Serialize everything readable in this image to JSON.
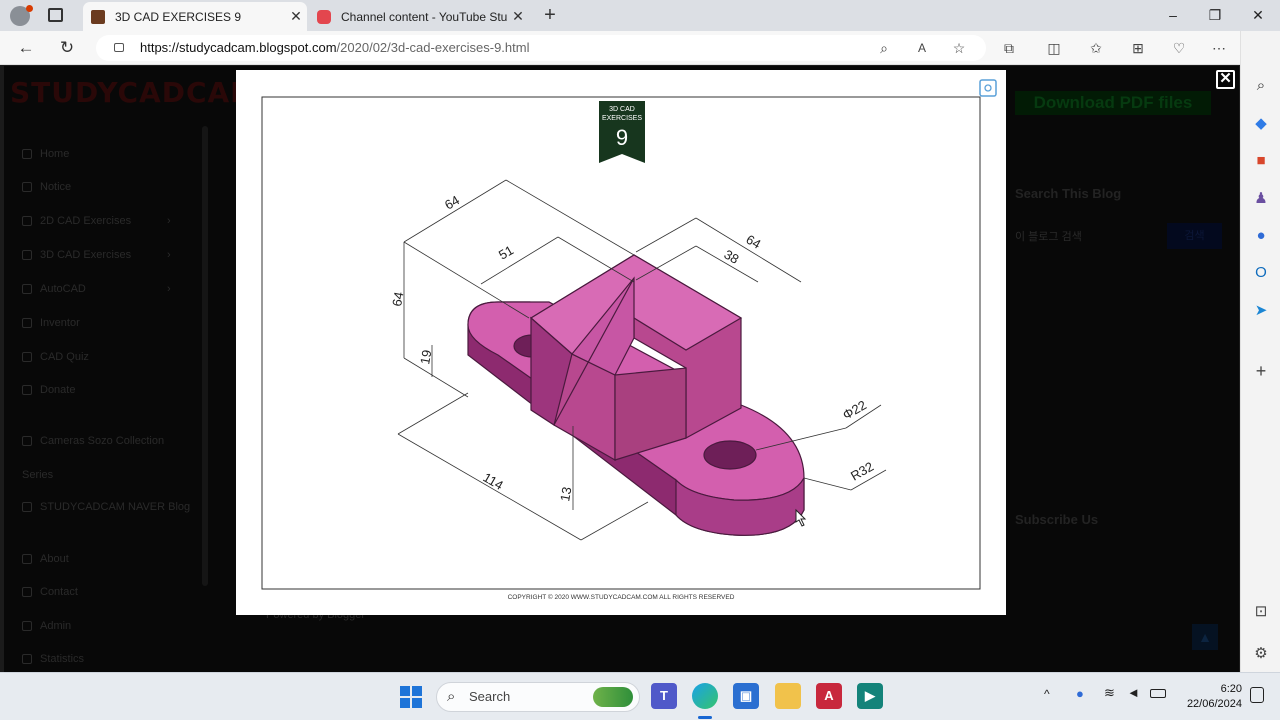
{
  "browser": {
    "tabs": [
      {
        "title": "3D CAD EXERCISES 9",
        "active": true
      },
      {
        "title": "Channel content - YouTube Studio",
        "active": false
      }
    ],
    "url_host": "https://studycadcam.blogspot.com",
    "url_path": "/2020/02/3d-cad-exercises-9.html"
  },
  "site": {
    "logo": "STUDYCADCAM",
    "nav": [
      "Home",
      "Notice",
      "2D CAD Exercises",
      "3D CAD Exercises",
      "AutoCAD",
      "Inventor",
      "CAD Quiz",
      "Donate",
      "Cameras Sozo Collection",
      "Series",
      "STUDYCADCAM NAVER Blog",
      "About",
      "Contact",
      "Admin",
      "Statistics"
    ],
    "download_button": "Download PDF files",
    "search_title": "Search This Blog",
    "search_placeholder": "이 블로그 검색",
    "search_button": "검색",
    "subscribe_title": "Subscribe Us",
    "credit": "Powered by Blogger"
  },
  "drawing": {
    "badge_line1": "3D CAD",
    "badge_line2": "EXERCISES",
    "badge_number": "9",
    "copyright": "COPYRIGHT © 2020 WWW.STUDYCADCAM.COM ALL RIGHTS RESERVED",
    "dims": {
      "d64a": "64",
      "d51": "51",
      "d64b": "64",
      "d38": "38",
      "d64c": "64",
      "d19": "19",
      "d114": "114",
      "d13": "13",
      "dphi": "Φ22",
      "dr": "R32"
    },
    "model_color": "#d35fae"
  },
  "taskbar": {
    "search": "Search",
    "time": "6:20",
    "date": "22/06/2024"
  },
  "colors": {
    "accent": "#0a5a1c",
    "tabbar": "#dcdfe4"
  }
}
